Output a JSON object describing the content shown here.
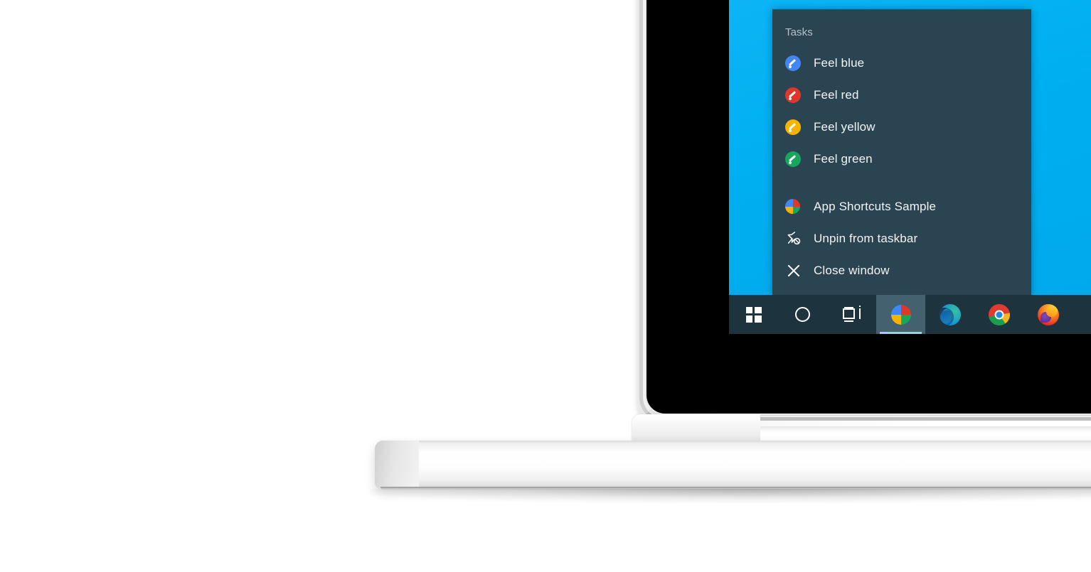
{
  "scene": {
    "description": "Windows 10 taskbar jump list shown on a laptop screen",
    "background_color": "#ffffff"
  },
  "device": {
    "name": "laptop",
    "bezel_color": "#000000",
    "body_color": "#f2f2f2"
  },
  "desktop": {
    "wallpaper_color": "#00b0f0"
  },
  "jumplist": {
    "header": "Tasks",
    "background_color": "#2b4452",
    "tasks": [
      {
        "label": "Feel blue",
        "icon": "brush-icon",
        "color": "#4285f4"
      },
      {
        "label": "Feel red",
        "icon": "brush-icon",
        "color": "#e0372c"
      },
      {
        "label": "Feel yellow",
        "icon": "brush-icon",
        "color": "#f5b400"
      },
      {
        "label": "Feel green",
        "icon": "brush-icon",
        "color": "#16a75c"
      }
    ],
    "actions": [
      {
        "label": "App Shortcuts Sample",
        "icon": "app-pie-icon"
      },
      {
        "label": "Unpin from taskbar",
        "icon": "unpin-icon"
      },
      {
        "label": "Close window",
        "icon": "close-icon"
      }
    ]
  },
  "taskbar": {
    "background_color": "#1d333e",
    "active_highlight_color": "#43616e",
    "active_underline_color": "#8fd3f5",
    "buttons": [
      {
        "name": "start",
        "icon": "windows-logo-icon",
        "label": "Start"
      },
      {
        "name": "cortana",
        "icon": "cortana-circle-icon",
        "label": "Cortana"
      },
      {
        "name": "task-view",
        "icon": "task-view-icon",
        "label": "Task View"
      }
    ],
    "apps": [
      {
        "name": "app-shortcuts-sample",
        "icon": "app-pie-icon",
        "label": "App Shortcuts Sample",
        "active": true
      },
      {
        "name": "microsoft-edge",
        "icon": "edge-icon",
        "label": "Microsoft Edge",
        "active": false
      },
      {
        "name": "google-chrome",
        "icon": "chrome-icon",
        "label": "Google Chrome",
        "active": false
      },
      {
        "name": "mozilla-firefox",
        "icon": "firefox-icon",
        "label": "Mozilla Firefox",
        "active": false
      }
    ]
  },
  "app_icon_colors": {
    "top_left": "#4285f4",
    "top_right": "#e0372c",
    "bottom_left": "#f5b400",
    "bottom_right": "#16a75c"
  }
}
